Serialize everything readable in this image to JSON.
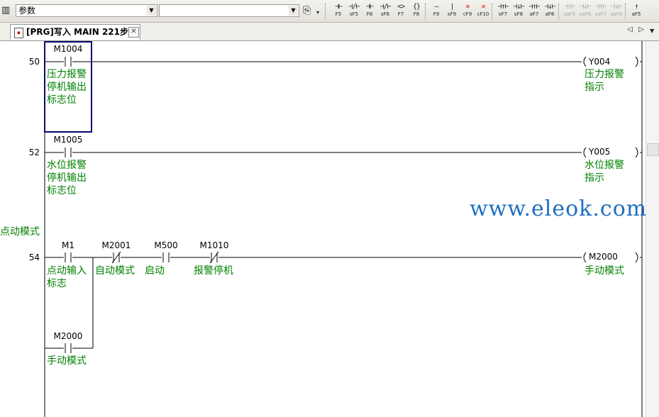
{
  "toolbar": {
    "combo_left_value": "参数",
    "combo_right_value": "",
    "buttons": [
      {
        "sym": "⊣⊢",
        "key": "F5",
        "style": "normal"
      },
      {
        "sym": "⊣/⊢",
        "key": "sF5",
        "style": "normal"
      },
      {
        "sym": "⊣⊢",
        "key": "F6",
        "style": "normal"
      },
      {
        "sym": "⊣/⊢",
        "key": "sF6",
        "style": "normal"
      },
      {
        "sym": "<>",
        "key": "F7",
        "style": "normal"
      },
      {
        "sym": "{}",
        "key": "F8",
        "style": "normal"
      },
      {
        "sym": "—",
        "key": "F9",
        "style": "normal"
      },
      {
        "sym": "|",
        "key": "sF9",
        "style": "normal"
      },
      {
        "sym": "✕",
        "key": "cF9",
        "style": "red"
      },
      {
        "sym": "✕",
        "key": "cF10",
        "style": "red"
      },
      {
        "sym": "⊣↑⊢",
        "key": "sF7",
        "style": "normal"
      },
      {
        "sym": "⊣↓⊢",
        "key": "sF8",
        "style": "normal"
      },
      {
        "sym": "⊣↑⊢",
        "key": "aF7",
        "style": "normal"
      },
      {
        "sym": "⊣↓⊢",
        "key": "aF8",
        "style": "normal"
      },
      {
        "sym": "⊣↑⊢",
        "key": "saF5",
        "style": "gray"
      },
      {
        "sym": "⊣↓⊢",
        "key": "saF6",
        "style": "gray"
      },
      {
        "sym": "⊣↑⊢",
        "key": "saF7",
        "style": "gray"
      },
      {
        "sym": "⊣↓⊢",
        "key": "saF8",
        "style": "gray"
      },
      {
        "sym": "↑",
        "key": "aF5",
        "style": "normal"
      }
    ]
  },
  "tab": {
    "title": "[PRG]写入 MAIN 221步",
    "close": "✕"
  },
  "nav": {
    "left": "◁",
    "right": "▷",
    "menu": "▼"
  },
  "ladder": {
    "step50": {
      "step": "50",
      "contact": {
        "device": "M1004",
        "comment": "压力报警\n停机输出\n标志位"
      },
      "coil": {
        "device": "Y004",
        "comment": "压力报警\n指示"
      }
    },
    "step52": {
      "step": "52",
      "contact": {
        "device": "M1005",
        "comment": "水位报警\n停机输出\n标志位"
      },
      "coil": {
        "device": "Y005",
        "comment": "水位报警\n指示"
      }
    },
    "statement": "点动模式",
    "step54": {
      "step": "54",
      "contacts": [
        {
          "device": "M1",
          "comment": "点动输入\n标志",
          "type": "NO"
        },
        {
          "device": "M2001",
          "comment": "自动模式",
          "type": "NC"
        },
        {
          "device": "M500",
          "comment": "启动",
          "type": "NO"
        },
        {
          "device": "M1010",
          "comment": "报警停机",
          "type": "NC"
        }
      ],
      "branch": {
        "device": "M2000",
        "comment": "手动模式",
        "type": "NO"
      },
      "coil": {
        "device": "M2000",
        "comment": "手动模式"
      }
    }
  },
  "watermark": "www.eleok.com",
  "colors": {
    "comment": "#008000",
    "watermark": "#1e6fc0",
    "cursor": "#0a0a6e"
  }
}
